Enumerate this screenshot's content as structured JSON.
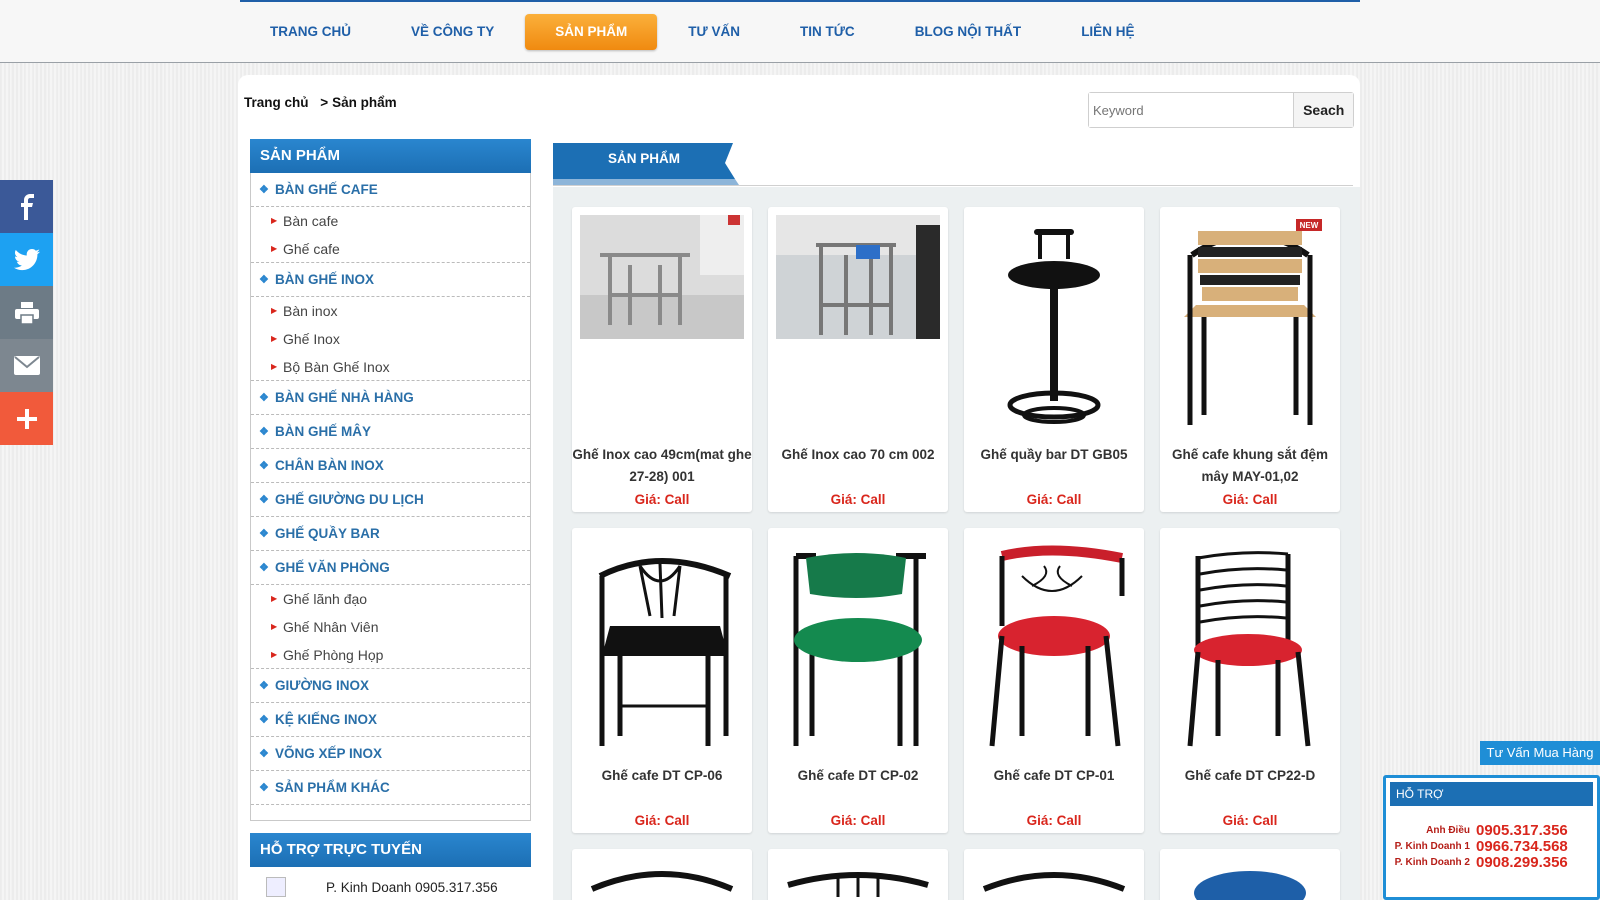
{
  "nav": {
    "items": [
      {
        "label": "TRANG CHỦ"
      },
      {
        "label": "VỀ CÔNG TY"
      },
      {
        "label": "SẢN PHẨM"
      },
      {
        "label": "TƯ VẤN"
      },
      {
        "label": "TIN TỨC"
      },
      {
        "label": "BLOG NỘI THẤT"
      },
      {
        "label": "LIÊN HỆ"
      }
    ],
    "active": "SẢN PHẨM"
  },
  "breadcrumb": {
    "home": "Trang chủ",
    "separator": ">",
    "current": "Sản phẩm"
  },
  "search": {
    "placeholder": "Keyword",
    "button": "Seach"
  },
  "sidebar": {
    "title": "SẢN PHẨM",
    "categories": [
      {
        "label": "BÀN GHẾ CAFE",
        "children": [
          "Bàn cafe",
          "Ghế cafe"
        ]
      },
      {
        "label": "BÀN GHẾ INOX",
        "children": [
          "Bàn inox",
          "Ghế Inox",
          "Bộ Bàn Ghế Inox"
        ]
      },
      {
        "label": "BÀN GHẾ NHÀ HÀNG",
        "children": []
      },
      {
        "label": "BÀN GHẾ MÂY",
        "children": []
      },
      {
        "label": "CHÂN BÀN INOX",
        "children": []
      },
      {
        "label": "GHẾ GIƯỜNG DU LỊCH",
        "children": []
      },
      {
        "label": "GHẾ QUẦY BAR",
        "children": []
      },
      {
        "label": "GHẾ VĂN PHÒNG",
        "children": [
          "Ghế lãnh đạo",
          "Ghế Nhân Viên",
          "Ghế Phòng Họp"
        ]
      },
      {
        "label": "GIƯỜNG INOX",
        "children": []
      },
      {
        "label": "KỆ KIẾNG INOX",
        "children": []
      },
      {
        "label": "VÕNG XẾP INOX",
        "children": []
      },
      {
        "label": "SẢN PHẨM KHÁC",
        "children": []
      }
    ],
    "support_title": "HỖ TRỢ TRỰC TUYẾN",
    "support_line": "P. Kinh Doanh 0905.317.356"
  },
  "content": {
    "section_title": "SẢN PHẨM",
    "products": [
      {
        "name": "Ghế Inox cao 49cm(mat ghe 27-28) 001",
        "price": "Giá: Call",
        "icon": "stool-photo",
        "badge": ""
      },
      {
        "name": "Ghế Inox cao 70 cm 002",
        "price": "Giá: Call",
        "icon": "tall-stool-photo",
        "badge": ""
      },
      {
        "name": "Ghế quầy bar DT GB05",
        "price": "Giá: Call",
        "icon": "bar-stool",
        "badge": ""
      },
      {
        "name": "Ghế cafe khung sắt đệm mây MAY-01,02",
        "price": "Giá: Call",
        "icon": "rattan-chair",
        "badge": "NEW"
      },
      {
        "name": "Ghế cafe DT CP-06",
        "price": "Giá: Call",
        "icon": "black-chair",
        "badge": ""
      },
      {
        "name": "Ghế cafe DT CP-02",
        "price": "Giá: Call",
        "icon": "green-chair",
        "badge": ""
      },
      {
        "name": "Ghế cafe DT CP-01",
        "price": "Giá: Call",
        "icon": "red-heart-chair",
        "badge": ""
      },
      {
        "name": "Ghế cafe DT CP22-D",
        "price": "Giá: Call",
        "icon": "red-ladder-chair",
        "badge": ""
      }
    ]
  },
  "social": [
    {
      "icon": "facebook-icon",
      "color": "#3b5998"
    },
    {
      "icon": "twitter-icon",
      "color": "#1da1f2"
    },
    {
      "icon": "print-icon",
      "color": "#6d7b86"
    },
    {
      "icon": "email-icon",
      "color": "#7d8790"
    },
    {
      "icon": "plus-icon",
      "color": "#f15a3b"
    }
  ],
  "widget": {
    "tab_label": "Tư Vấn Mua Hàng",
    "title": "HỖ TRỢ",
    "rows": [
      {
        "label": "Anh Điều",
        "phone": "0905.317.356"
      },
      {
        "label": "P. Kinh Doanh 1",
        "phone": "0966.734.568"
      },
      {
        "label": "P. Kinh Doanh 2",
        "phone": "0908.299.356"
      }
    ]
  },
  "colors": {
    "brand_blue": "#1f5fa8",
    "accent_orange": "#f39c12",
    "price_red": "#d9261c"
  }
}
